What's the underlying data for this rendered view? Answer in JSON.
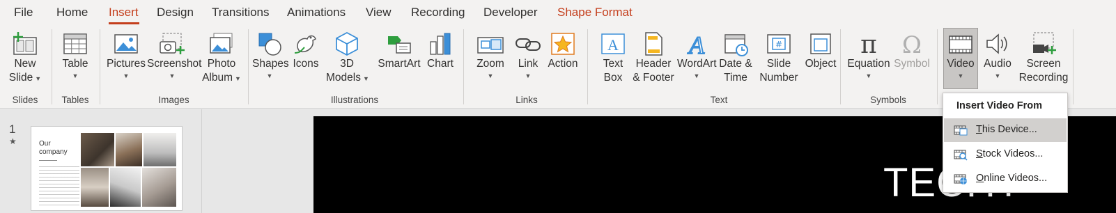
{
  "tabs": [
    {
      "label": "File"
    },
    {
      "label": "Home"
    },
    {
      "label": "Insert"
    },
    {
      "label": "Design"
    },
    {
      "label": "Transitions"
    },
    {
      "label": "Animations"
    },
    {
      "label": "View"
    },
    {
      "label": "Recording"
    },
    {
      "label": "Developer"
    },
    {
      "label": "Shape Format"
    }
  ],
  "active_tab": "Insert",
  "accent_color": "#c43e1c",
  "ribbon": {
    "slides": {
      "new_slide_1": "New",
      "new_slide_2": "Slide",
      "group": "Slides"
    },
    "tables": {
      "table": "Table",
      "group": "Tables"
    },
    "images": {
      "pictures": "Pictures",
      "screenshot": "Screenshot",
      "photo_album_1": "Photo",
      "photo_album_2": "Album",
      "group": "Images"
    },
    "illustrations": {
      "shapes": "Shapes",
      "icons": "Icons",
      "models_1": "3D",
      "models_2": "Models",
      "smartart": "SmartArt",
      "chart": "Chart",
      "group": "Illustrations"
    },
    "links": {
      "zoom": "Zoom",
      "link": "Link",
      "action": "Action",
      "group": "Links"
    },
    "text": {
      "textbox_1": "Text",
      "textbox_2": "Box",
      "header_1": "Header",
      "header_2": "& Footer",
      "wordart": "WordArt",
      "datetime_1": "Date &",
      "datetime_2": "Time",
      "slidenum_1": "Slide",
      "slidenum_2": "Number",
      "object": "Object",
      "group": "Text"
    },
    "symbols": {
      "equation": "Equation",
      "symbol": "Symbol",
      "group": "Symbols"
    },
    "media": {
      "video": "Video",
      "audio": "Audio",
      "screen_rec_1": "Screen",
      "screen_rec_2": "Recording"
    }
  },
  "thumbnail": {
    "slide_number": "1",
    "title": "Our\ncompany"
  },
  "canvas_text": "TECHT",
  "dropdown": {
    "header": "Insert Video From",
    "items": [
      {
        "ul": "T",
        "rest": "his Device...",
        "icon": "video-file-icon"
      },
      {
        "ul": "S",
        "rest": "tock Videos...",
        "icon": "stock-video-icon"
      },
      {
        "ul": "O",
        "rest": "nline Videos...",
        "icon": "online-video-icon"
      }
    ]
  }
}
